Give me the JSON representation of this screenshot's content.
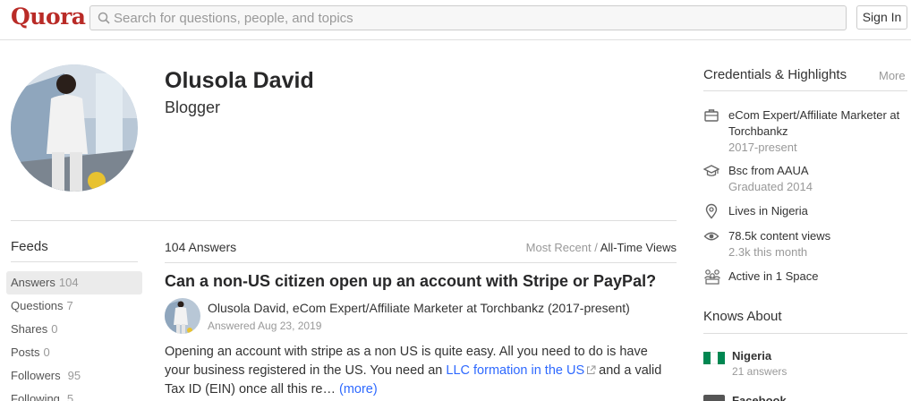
{
  "header": {
    "logo": "Quora",
    "search_placeholder": "Search for questions, people, and topics",
    "signin_label": "Sign In"
  },
  "profile": {
    "name": "Olusola David",
    "tagline": "Blogger"
  },
  "feeds": {
    "title": "Feeds",
    "items": [
      {
        "label": "Answers",
        "count": "104",
        "active": true
      },
      {
        "label": "Questions",
        "count": "7"
      },
      {
        "label": "Shares",
        "count": "0"
      },
      {
        "label": "Posts",
        "count": "0"
      },
      {
        "label": "Followers",
        "count": "95"
      },
      {
        "label": "Following",
        "count": "5"
      }
    ]
  },
  "answers": {
    "count_label": "104 Answers",
    "sort_recent": "Most Recent",
    "sort_sep": " / ",
    "sort_views": "All-Time Views",
    "question": "Can a non-US citizen open up an account with Stripe or PayPal?",
    "author_line": "Olusola David, eCom Expert/Affiliate Marketer at Torchbankz (2017-present)",
    "answered": "Answered Aug 23, 2019",
    "text_before_link": "Opening an account with stripe as a non US is quite easy. All you need to do is have your business registered in the US. You need an ",
    "link_text": "LLC formation in the US",
    "text_after_link": "and a valid Tax ID (EIN) once all this re… ",
    "more_label": "(more)"
  },
  "credentials": {
    "title": "Credentials & Highlights",
    "more_label": "More",
    "items": [
      {
        "icon": "briefcase-icon",
        "text": "eCom Expert/Affiliate Marketer at Torchbankz",
        "sub": "2017-present"
      },
      {
        "icon": "graduation-cap-icon",
        "text": "Bsc from AAUA",
        "sub": "Graduated 2014"
      },
      {
        "icon": "location-icon",
        "text": "Lives in Nigeria",
        "sub": ""
      },
      {
        "icon": "eye-icon",
        "text": "78.5k content views",
        "sub": "2.3k this month"
      },
      {
        "icon": "spaces-icon",
        "text_prefix": "Active in ",
        "text_number": "1",
        "text_suffix": " Space",
        "sub": ""
      }
    ]
  },
  "knows_about": {
    "title": "Knows About",
    "topics": [
      {
        "name": "Nigeria",
        "count": "21 answers",
        "flag_colors": [
          "#008751",
          "#ffffff",
          "#008751"
        ]
      },
      {
        "name": "Facebook",
        "count": ""
      }
    ]
  },
  "colors": {
    "brand": "#b92b27",
    "link": "#2e69ff",
    "muted": "#999999"
  }
}
